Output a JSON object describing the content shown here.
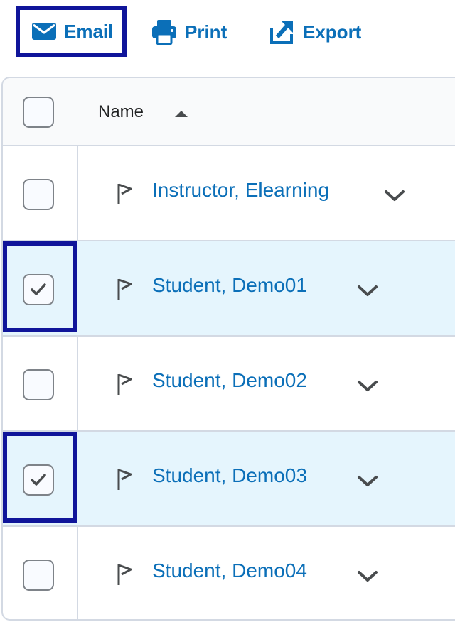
{
  "toolbar": {
    "email_label": "Email",
    "print_label": "Print",
    "export_label": "Export"
  },
  "table": {
    "header": {
      "name_label": "Name",
      "sort": "ascending"
    },
    "rows": [
      {
        "name": "Instructor, Elearning",
        "checked": false
      },
      {
        "name": "Student, Demo01",
        "checked": true
      },
      {
        "name": "Student, Demo02",
        "checked": false
      },
      {
        "name": "Student, Demo03",
        "checked": true
      },
      {
        "name": "Student, Demo04",
        "checked": false
      }
    ]
  },
  "colors": {
    "link": "#0b6fb8",
    "focus_outline": "#10159a",
    "selected_row": "#e5f5fd",
    "border": "#d3d9e3"
  },
  "icons": [
    "envelope-icon",
    "printer-icon",
    "export-icon",
    "sort-up-icon",
    "flag-icon",
    "chevron-down-icon",
    "checkmark-icon"
  ]
}
